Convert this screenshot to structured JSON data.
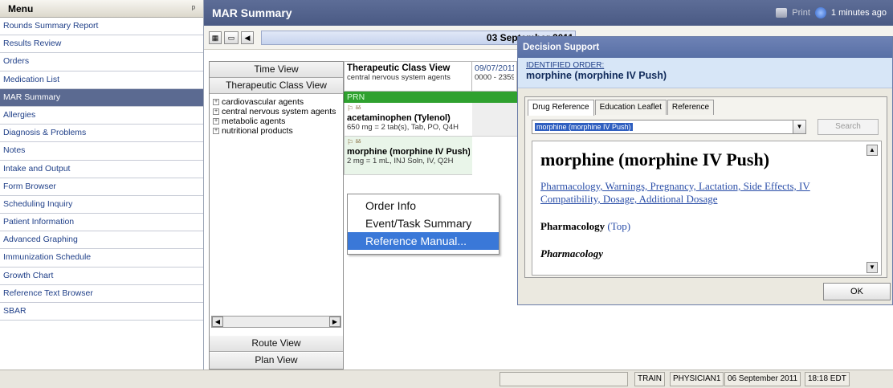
{
  "menu": {
    "header": "Menu",
    "pin": "ᵖ",
    "items": [
      "Rounds Summary Report",
      "Results Review",
      "Orders",
      "Medication List",
      "MAR Summary",
      "Allergies",
      "Diagnosis & Problems",
      "Notes",
      "Intake and Output",
      "Form Browser",
      "Scheduling Inquiry",
      "Patient Information",
      "Advanced Graphing",
      "Immunization Schedule",
      "Growth Chart",
      "Reference Text Browser",
      "SBAR"
    ],
    "active_index": 4
  },
  "titlebar": {
    "title": "MAR Summary",
    "print": "Print",
    "refresh": "1 minutes ago"
  },
  "nav": {
    "date": "03 September 2011"
  },
  "views": {
    "time": "Time View",
    "therapeutic": "Therapeutic Class View",
    "route": "Route View",
    "plan": "Plan View",
    "tree": [
      "cardiovascular agents",
      "central nervous system agents",
      "metabolic agents",
      "nutritional products"
    ]
  },
  "grid": {
    "header_title": "Therapeutic Class View",
    "header_sub": "central nervous system agents",
    "date_col": "09/07/2011",
    "time_col": "0000 - 2359",
    "prn": "PRN",
    "meds": [
      {
        "icons": "⚐ ᵟᵟ",
        "name": "acetaminophen (Tylenol)",
        "dose": "650 mg = 2 tab(s), Tab, PO, Q4H"
      },
      {
        "icons": "⚐ ᵟᵟ",
        "name": "morphine (morphine IV Push)",
        "dose": "2 mg = 1 mL, INJ Soln, IV, Q2H"
      }
    ]
  },
  "context_menu": {
    "items": [
      "Order Info",
      "Event/Task Summary",
      "Reference Manual..."
    ],
    "highlight_index": 2
  },
  "dialog": {
    "title": "Decision Support",
    "identified_label": "IDENTIFIED ORDER:",
    "order_name": "morphine (morphine IV Push)",
    "tabs": [
      "Drug Reference",
      "Education Leaflet",
      "Reference"
    ],
    "drug_select": "morphine (morphine IV Push)",
    "search": "Search",
    "ref_title": "morphine (morphine IV Push)",
    "ref_links": "Pharmacology, Warnings, Pregnancy, Lactation, Side Effects, IV Compatibility, Dosage, Additional Dosage",
    "section": "Pharmacology",
    "section_link": "(Top)",
    "subsection": "Pharmacology",
    "ok": "OK"
  },
  "status": {
    "env": "TRAIN",
    "user": "PHYSICIAN1",
    "date": "06 September 2011",
    "time": "18:18 EDT"
  },
  "colors": {
    "menu_active": "#5b6a91",
    "titlebar": "#4f5f89",
    "prn_green": "#2fa12f",
    "highlight": "#3a78d8"
  }
}
